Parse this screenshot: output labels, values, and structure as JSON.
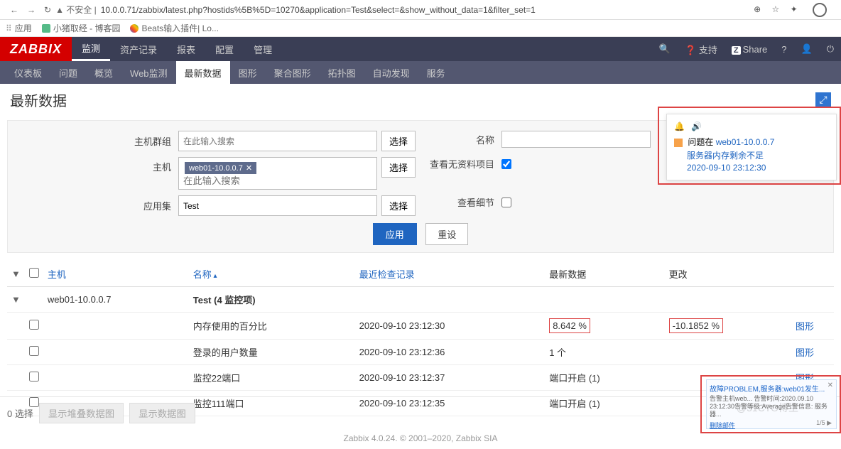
{
  "browser": {
    "url": "10.0.0.71/zabbix/latest.php?hostids%5B%5D=10270&application=Test&select=&show_without_data=1&filter_set=1",
    "warn": "不安全"
  },
  "bookmarks": {
    "apps": "应用",
    "item1": "小猪取经 - 博客园",
    "item2": "Beats输入插件| Lo..."
  },
  "logo": "ZABBIX",
  "topnav": {
    "t1": "监测",
    "t2": "资产记录",
    "t3": "报表",
    "t4": "配置",
    "t5": "管理",
    "support": "支持",
    "share": "Share"
  },
  "subnav": {
    "s1": "仪表板",
    "s2": "问题",
    "s3": "概览",
    "s4": "Web监测",
    "s5": "最新数据",
    "s6": "图形",
    "s7": "聚合图形",
    "s8": "拓扑图",
    "s9": "自动发现",
    "s10": "服务"
  },
  "page_title": "最新数据",
  "filter": {
    "hostgroup_label": "主机群组",
    "host_label": "主机",
    "appset_label": "应用集",
    "name_label": "名称",
    "show_no_data_label": "查看无资料项目",
    "show_detail_label": "查看细节",
    "placeholder": "在此输入搜索",
    "host_tag": "web01-10.0.0.7",
    "appset_value": "Test",
    "select": "选择",
    "apply": "应用",
    "reset": "重设"
  },
  "table": {
    "headers": {
      "host": "主机",
      "name": "名称",
      "last_check": "最近检查记录",
      "last_data": "最新数据",
      "change": "更改",
      "graph": "图形"
    },
    "group_host": "web01-10.0.0.7",
    "group_label": "Test (4 监控项)",
    "rows": [
      {
        "name": "内存使用的百分比",
        "check": "2020-09-10 23:12:30",
        "data": "8.642 %",
        "change": "-10.1852 %",
        "hl": true
      },
      {
        "name": "登录的用户数量",
        "check": "2020-09-10 23:12:36",
        "data": "1 个",
        "change": "",
        "hl": false
      },
      {
        "name": "监控22端口",
        "check": "2020-09-10 23:12:37",
        "data": "端口开启 (1)",
        "change": "",
        "hl": false
      },
      {
        "name": "监控111端口",
        "check": "2020-09-10 23:12:35",
        "data": "端口开启 (1)",
        "change": "",
        "hl": false
      }
    ]
  },
  "footer": {
    "selected": "0 选择",
    "btn1": "显示堆叠数据图",
    "btn2": "显示数据图",
    "copyright": "Zabbix 4.0.24. © 2001–2020, Zabbix SIA"
  },
  "notif": {
    "prefix": "问题在",
    "host": "web01-10.0.0.7",
    "line2": "服务器内存剩余不足",
    "time": "2020-09-10 23:12:30"
  },
  "toast": {
    "header": "故障PROBLEM,服务器:web01发生...",
    "body": "告警主机web... 告警时间:2020.09.10 23:12:30告警等级:Average告警信息: 服务器...",
    "del": "删除邮件",
    "pager": "1/5"
  },
  "watermark": "@51CTO博主"
}
